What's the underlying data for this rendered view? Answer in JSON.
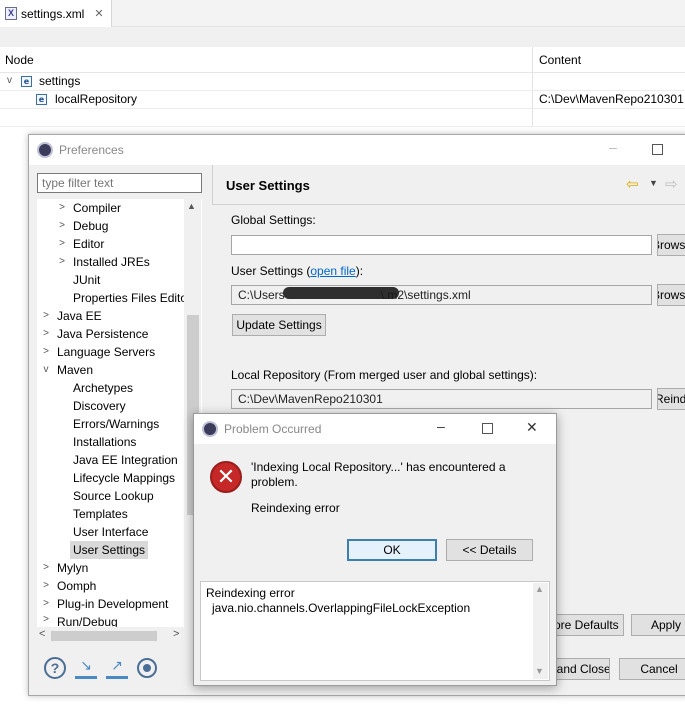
{
  "editor": {
    "tab_label": "settings.xml",
    "tab_icon": "xml-file-icon",
    "col_node": "Node",
    "col_content": "Content",
    "rows": [
      {
        "node": "settings",
        "content": ""
      },
      {
        "node": "localRepository",
        "content": "C:\\Dev\\MavenRepo210301"
      }
    ]
  },
  "preferences": {
    "title": "Preferences",
    "filter_placeholder": "type filter text",
    "tree": [
      {
        "label": "Compiler",
        "level": 1,
        "expander": ">"
      },
      {
        "label": "Debug",
        "level": 1,
        "expander": ">"
      },
      {
        "label": "Editor",
        "level": 1,
        "expander": ">"
      },
      {
        "label": "Installed JREs",
        "level": 1,
        "expander": ">"
      },
      {
        "label": "JUnit",
        "level": 1,
        "expander": ""
      },
      {
        "label": "Properties Files Editor",
        "level": 1,
        "expander": ""
      },
      {
        "label": "Java EE",
        "level": 0,
        "expander": ">"
      },
      {
        "label": "Java Persistence",
        "level": 0,
        "expander": ">"
      },
      {
        "label": "Language Servers",
        "level": 0,
        "expander": ">"
      },
      {
        "label": "Maven",
        "level": 0,
        "expander": "v"
      },
      {
        "label": "Archetypes",
        "level": 1,
        "expander": ""
      },
      {
        "label": "Discovery",
        "level": 1,
        "expander": ""
      },
      {
        "label": "Errors/Warnings",
        "level": 1,
        "expander": ""
      },
      {
        "label": "Installations",
        "level": 1,
        "expander": ""
      },
      {
        "label": "Java EE Integration",
        "level": 1,
        "expander": ""
      },
      {
        "label": "Lifecycle Mappings",
        "level": 1,
        "expander": ""
      },
      {
        "label": "Source Lookup",
        "level": 1,
        "expander": ""
      },
      {
        "label": "Templates",
        "level": 1,
        "expander": ""
      },
      {
        "label": "User Interface",
        "level": 1,
        "expander": ""
      },
      {
        "label": "User Settings",
        "level": 1,
        "expander": "",
        "selected": true
      },
      {
        "label": "Mylyn",
        "level": 0,
        "expander": ">"
      },
      {
        "label": "Oomph",
        "level": 0,
        "expander": ">"
      },
      {
        "label": "Plug-in Development",
        "level": 0,
        "expander": ">"
      },
      {
        "label": "Run/Debug",
        "level": 0,
        "expander": ">"
      }
    ],
    "page_title": "User Settings",
    "global_label": "Global Settings:",
    "global_value": "",
    "browse_label": "Browse...",
    "user_label_prefix": "User Settings (",
    "user_label_link": "open file",
    "user_label_suffix": "):",
    "user_value_start": "C:\\Users",
    "user_value_end": "\\.m2\\settings.xml",
    "update_button": "Update Settings",
    "local_repo_label": "Local Repository (From merged user and global settings):",
    "local_repo_value": "C:\\Dev\\MavenRepo210301",
    "reindex_button": "Reindex",
    "restore_defaults": "Restore Defaults",
    "apply": "Apply",
    "apply_and_close": "Apply and Close",
    "cancel": "Cancel"
  },
  "problem": {
    "title": "Problem Occurred",
    "message": "'Indexing Local Repository...' has encountered a problem.",
    "reason": "Reindexing error",
    "ok": "OK",
    "details": "<< Details",
    "detail_line1": "Reindexing error",
    "detail_line2": "java.nio.channels.OverlappingFileLockException"
  },
  "colors": {
    "error_red": "#c62828",
    "link_blue": "#0066cc",
    "dialog_bg": "#f0f0f0"
  }
}
